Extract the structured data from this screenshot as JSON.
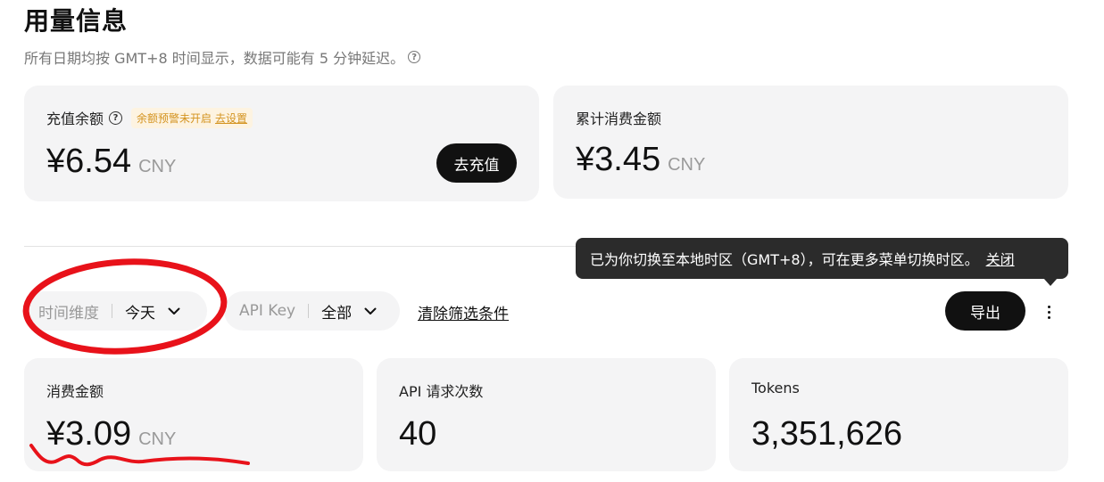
{
  "header": {
    "title": "用量信息",
    "subtitle": "所有日期均按 GMT+8 时间显示，数据可能有 5 分钟延迟。"
  },
  "balance_card": {
    "label": "充值余额",
    "badge_text": "余额预警未开启",
    "badge_link": "去设置",
    "amount": "¥6.54",
    "currency": "CNY",
    "recharge_button": "去充值"
  },
  "total_spend_card": {
    "label": "累计消费金额",
    "amount": "¥3.45",
    "currency": "CNY"
  },
  "tooltip": {
    "text": "已为你切换至本地时区（GMT+8），可在更多菜单切换时区。",
    "close_label": "关闭"
  },
  "filters": {
    "time_label": "时间维度",
    "time_value": "今天",
    "apikey_label": "API Key",
    "apikey_value": "全部",
    "clear_label": "清除筛选条件",
    "export_button": "导出"
  },
  "stats": {
    "spend_label": "消费金额",
    "spend_amount": "¥3.09",
    "spend_currency": "CNY",
    "requests_label": "API 请求次数",
    "requests_value": "40",
    "tokens_label": "Tokens",
    "tokens_value": "3,351,626"
  },
  "colors": {
    "annotation": "#e8121a",
    "badge_text": "#d4931f",
    "button_bg": "#111111"
  }
}
